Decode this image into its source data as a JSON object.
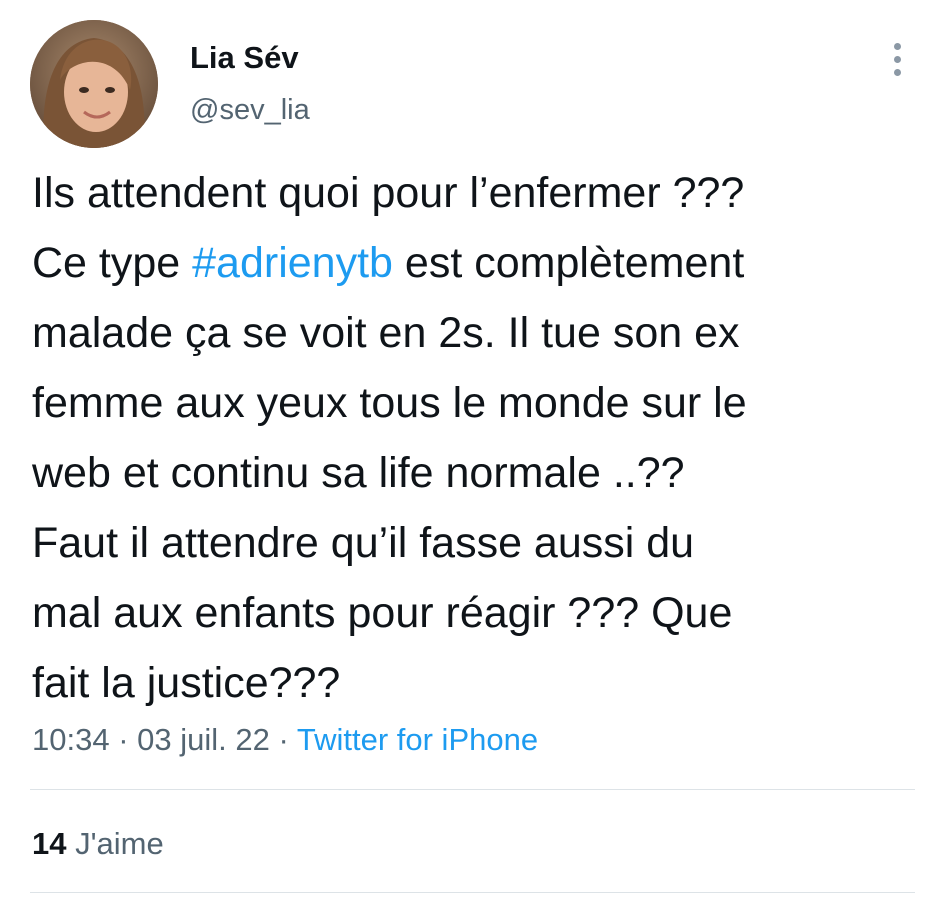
{
  "author": {
    "display_name": "Lia Sév",
    "handle": "@sev_lia",
    "avatar_icon": "profile-photo"
  },
  "menu": {
    "icon": "more-vertical-icon"
  },
  "tweet": {
    "lines": [
      {
        "before": "Ils attendent quoi pour l’enfermer ???"
      },
      {
        "before": "Ce type ",
        "hashtag": "#adrienytb",
        "after": " est complètement"
      },
      {
        "before": "malade ça se voit en 2s. Il tue son ex"
      },
      {
        "before": "femme aux yeux tous le monde sur le"
      },
      {
        "before": "web et continu sa life normale ..??"
      },
      {
        "before": "Faut il attendre qu’il fasse aussi du"
      },
      {
        "before": "mal aux enfants pour réagir ??? Que"
      },
      {
        "before": "fait la justice???"
      }
    ]
  },
  "meta": {
    "time": "10:34",
    "separator": " · ",
    "date": "03 juil. 22",
    "source": "Twitter for iPhone"
  },
  "stats": {
    "likes_count": "14",
    "likes_label": "J'aime"
  },
  "colors": {
    "text": "#0f1419",
    "secondary": "#536471",
    "link": "#1d9bf0",
    "divider": "#dde3e7"
  }
}
